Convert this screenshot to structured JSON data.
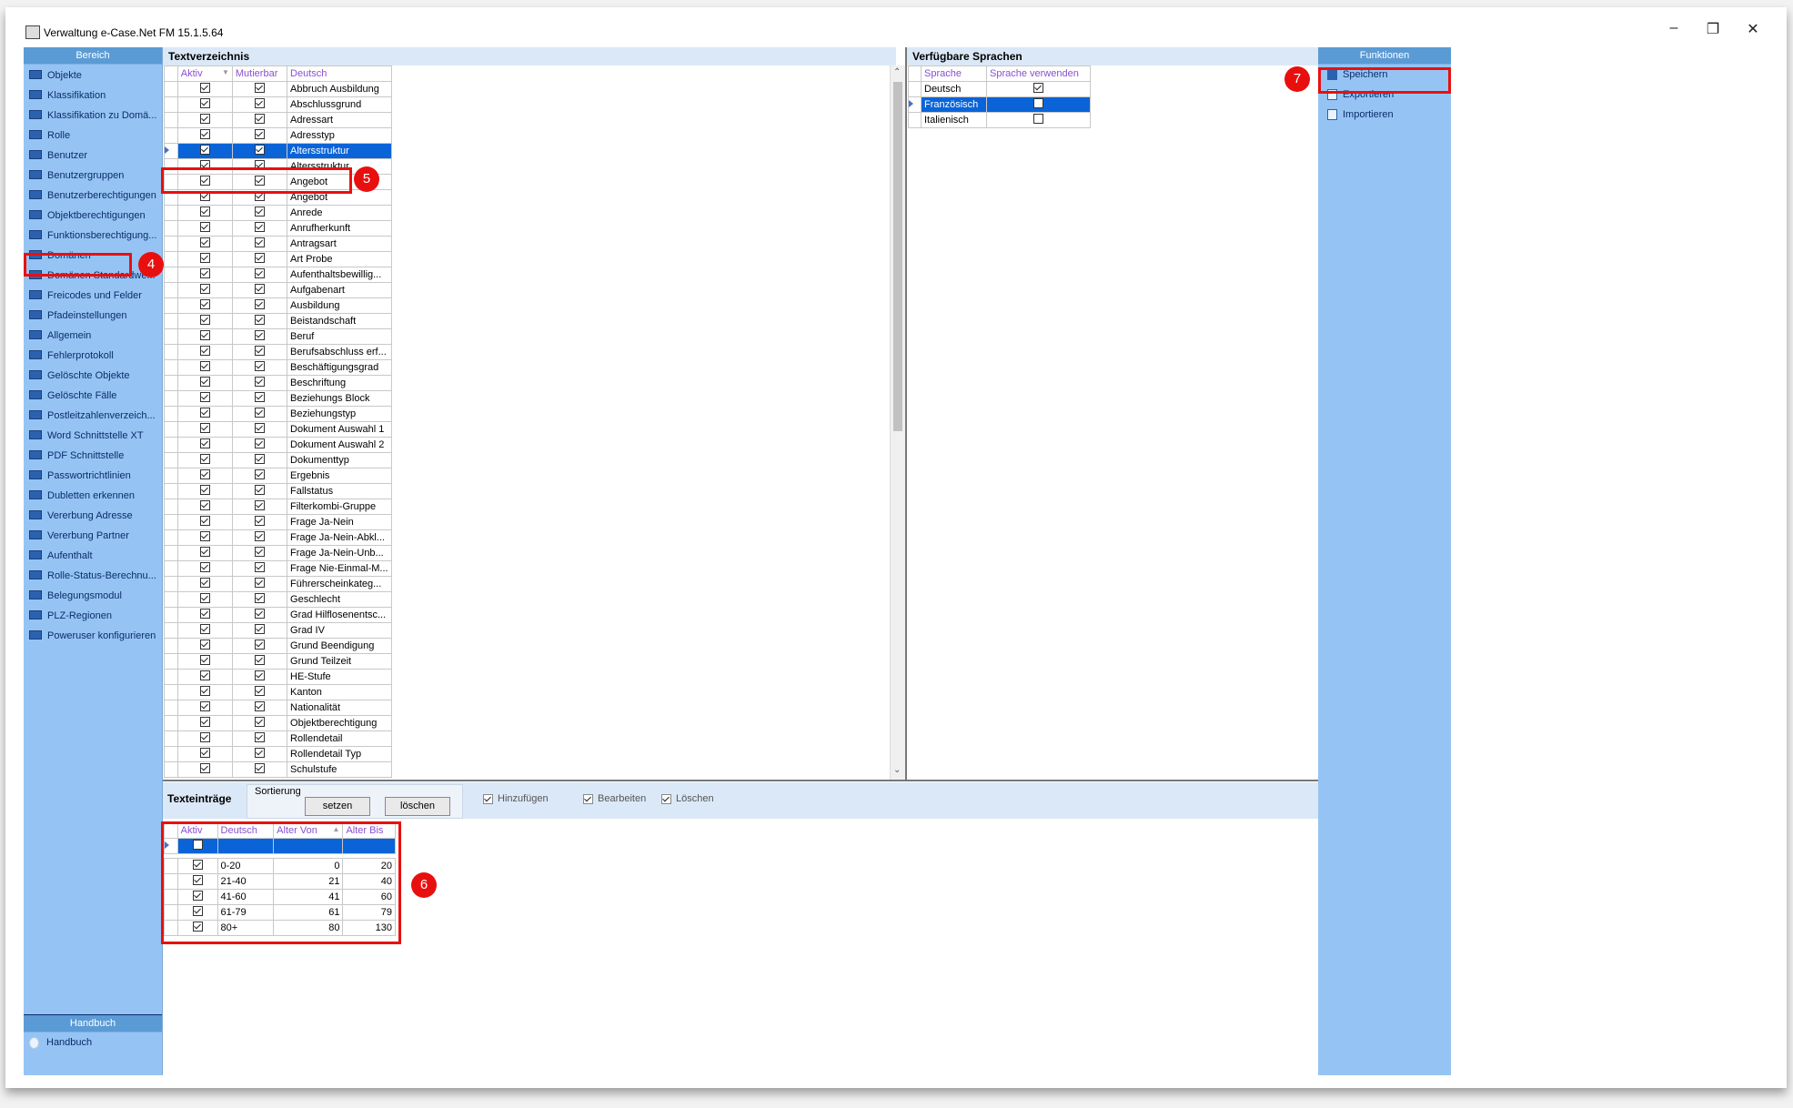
{
  "window": {
    "title": "Verwaltung e-Case.Net FM 15.1.5.64",
    "minimize": "–",
    "restore": "❐",
    "close": "✕"
  },
  "left": {
    "header": "Bereich",
    "items": [
      "Objekte",
      "Klassifikation",
      "Klassifikation zu Domä...",
      "Rolle",
      "Benutzer",
      "Benutzergruppen",
      "Benutzerberechtigungen",
      "Objektberechtigungen",
      "Funktionsberechtigung...",
      "Domänen",
      "Domänen Standardwe...",
      "Freicodes und Felder",
      "Pfadeinstellungen",
      "Allgemein",
      "Fehlerprotokoll",
      "Gelöschte Objekte",
      "Gelöschte Fälle",
      "Postleitzahlenverzeich...",
      "Word Schnittstelle XT",
      "PDF Schnittstelle",
      "Passwortrichtlinien",
      "Dubletten erkennen",
      "Vererbung Adresse",
      "Vererbung Partner",
      "Aufenthalt",
      "Rolle-Status-Berechnu...",
      "Belegungsmodul",
      "PLZ-Regionen",
      "Poweruser konfigurieren"
    ],
    "handbuch_header": "Handbuch",
    "handbuch_item": "Handbuch"
  },
  "textverzeichnis": {
    "title": "Textverzeichnis",
    "columns": {
      "aktiv": "Aktiv",
      "mutierbar": "Mutierbar",
      "deutsch": "Deutsch"
    },
    "rows": [
      "Abbruch Ausbildung",
      "Abschlussgrund",
      "Adressart",
      "Adresstyp",
      "Altersstruktur",
      "Altersstruktur",
      "Angebot",
      "Angebot",
      "Anrede",
      "Anrufherkunft",
      "Antragsart",
      "Art Probe",
      "Aufenthaltsbewillig...",
      "Aufgabenart",
      "Ausbildung",
      "Beistandschaft",
      "Beruf",
      "Berufsabschluss erf...",
      "Beschäftigungsgrad",
      "Beschriftung",
      "Beziehungs Block",
      "Beziehungstyp",
      "Dokument Auswahl 1",
      "Dokument Auswahl 2",
      "Dokumenttyp",
      "Ergebnis",
      "Fallstatus",
      "Filterkombi-Gruppe",
      "Frage Ja-Nein",
      "Frage Ja-Nein-Abkl...",
      "Frage Ja-Nein-Unb...",
      "Frage Nie-Einmal-M...",
      "Führerscheinkateg...",
      "Geschlecht",
      "Grad Hilflosenentsc...",
      "Grad IV",
      "Grund Beendigung",
      "Grund Teilzeit",
      "HE-Stufe",
      "Kanton",
      "Nationalität",
      "Objektberechtigung",
      "Rollendetail",
      "Rollendetail Typ",
      "Schulstufe"
    ],
    "selected_row": "Altersstruktur"
  },
  "sprachen": {
    "title": "Verfügbare Sprachen",
    "columns": {
      "sprache": "Sprache",
      "verwenden": "Sprache verwenden"
    },
    "rows": [
      {
        "sprache": "Deutsch",
        "checked": true
      },
      {
        "sprache": "Französisch",
        "checked": false
      },
      {
        "sprache": "Italienisch",
        "checked": false
      }
    ]
  },
  "texteintraege": {
    "title": "Texteinträge",
    "sortierung": "Sortierung",
    "setzen": "setzen",
    "loeschen": "löschen",
    "opt_hinzufuegen": "Hinzufügen",
    "opt_bearbeiten": "Bearbeiten",
    "opt_loeschen": "Löschen",
    "columns": {
      "aktiv": "Aktiv",
      "deutsch": "Deutsch",
      "von": "Alter Von",
      "bis": "Alter Bis"
    },
    "rows": [
      {
        "deutsch": "0-20",
        "von": "0",
        "bis": "20"
      },
      {
        "deutsch": "21-40",
        "von": "21",
        "bis": "40"
      },
      {
        "deutsch": "41-60",
        "von": "41",
        "bis": "60"
      },
      {
        "deutsch": "61-79",
        "von": "61",
        "bis": "79"
      },
      {
        "deutsch": "80+",
        "von": "80",
        "bis": "130"
      }
    ]
  },
  "funktionen": {
    "header": "Funktionen",
    "items": [
      "Speichern",
      "Exportieren",
      "Importieren"
    ]
  },
  "badges": {
    "b4": "4",
    "b5": "5",
    "b6": "6",
    "b7": "7"
  },
  "colors": {
    "accent_red": "#e8100e",
    "selection": "#0a64d8",
    "panel": "#95c4f4"
  }
}
